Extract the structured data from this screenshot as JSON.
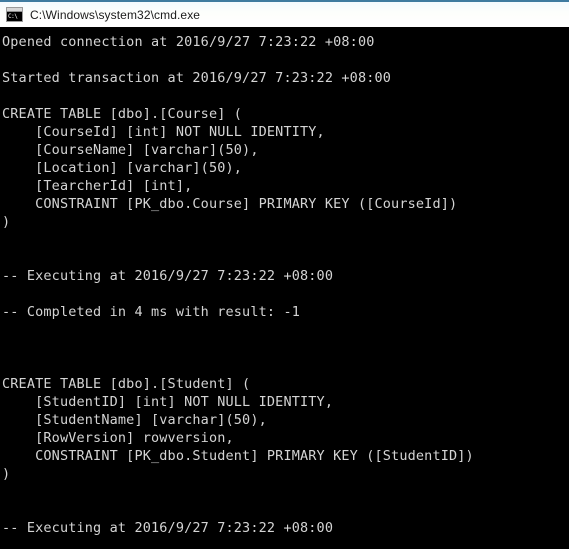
{
  "window": {
    "title": "C:\\Windows\\system32\\cmd.exe",
    "icon_name": "cmd-console-icon",
    "icon_glyph": "C:\\",
    "titlebar_bg": "#fdfefc",
    "titlebar_accent": "#3f7ba0",
    "title_color": "#1b1b1b"
  },
  "console": {
    "background": "#000000",
    "foreground": "#d4d4d4",
    "lines": [
      "Opened connection at 2016/9/27 7:23:22 +08:00",
      "",
      "Started transaction at 2016/9/27 7:23:22 +08:00",
      "",
      "CREATE TABLE [dbo].[Course] (",
      "    [CourseId] [int] NOT NULL IDENTITY,",
      "    [CourseName] [varchar](50),",
      "    [Location] [varchar](50),",
      "    [TearcherId] [int],",
      "    CONSTRAINT [PK_dbo.Course] PRIMARY KEY ([CourseId])",
      ")",
      "",
      "",
      "-- Executing at 2016/9/27 7:23:22 +08:00",
      "",
      "-- Completed in 4 ms with result: -1",
      "",
      "",
      "",
      "CREATE TABLE [dbo].[Student] (",
      "    [StudentID] [int] NOT NULL IDENTITY,",
      "    [StudentName] [varchar](50),",
      "    [RowVersion] rowversion,",
      "    CONSTRAINT [PK_dbo.Student] PRIMARY KEY ([StudentID])",
      ")",
      "",
      "",
      "-- Executing at 2016/9/27 7:23:22 +08:00"
    ]
  }
}
